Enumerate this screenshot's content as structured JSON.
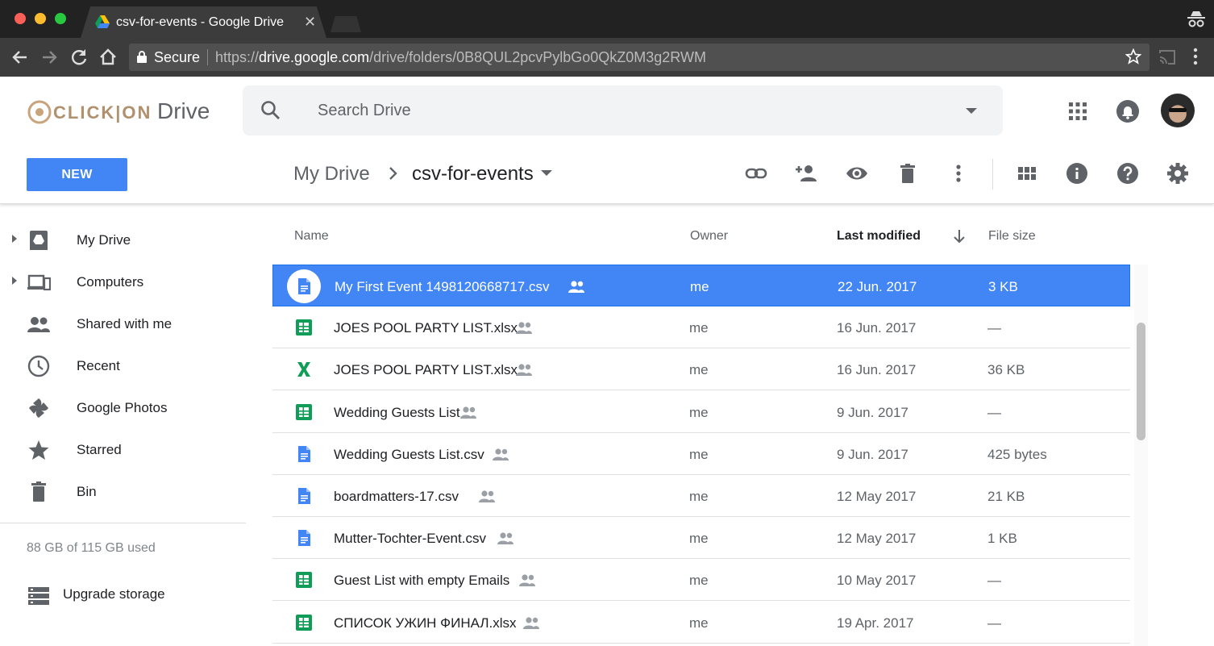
{
  "browser": {
    "tab_title": "csv-for-events - Google Drive",
    "secure_label": "Secure",
    "url_scheme": "https://",
    "url_host": "drive.google.com",
    "url_path": "/drive/folders/0B8QUL2pcvPylbGo0QkZ0M3g2RWM"
  },
  "header": {
    "brand": "CLICK|ON",
    "product": "Drive",
    "search_placeholder": "Search Drive"
  },
  "toolbar": {
    "new_label": "NEW",
    "breadcrumb_root": "My Drive",
    "breadcrumb_current": "csv-for-events"
  },
  "sidebar": {
    "items": [
      {
        "label": "My Drive",
        "icon": "my-drive-icon"
      },
      {
        "label": "Computers",
        "icon": "computers-icon"
      },
      {
        "label": "Shared with me",
        "icon": "shared-icon"
      },
      {
        "label": "Recent",
        "icon": "clock-icon"
      },
      {
        "label": "Google Photos",
        "icon": "photos-icon"
      },
      {
        "label": "Starred",
        "icon": "star-icon"
      },
      {
        "label": "Bin",
        "icon": "trash-icon"
      }
    ],
    "storage": "88 GB of 115 GB used",
    "upgrade": "Upgrade storage"
  },
  "list": {
    "columns": {
      "name": "Name",
      "owner": "Owner",
      "modified": "Last modified",
      "size": "File size"
    },
    "rows": [
      {
        "name": "My First Event 1498120668717.csv",
        "owner": "me",
        "modified": "22 Jun. 2017",
        "size": "3 KB",
        "type": "doc",
        "selected": true
      },
      {
        "name": "JOES POOL PARTY LIST.xlsx",
        "owner": "me",
        "modified": "16 Jun. 2017",
        "size": "—",
        "type": "sheet"
      },
      {
        "name": "JOES POOL PARTY LIST.xlsx",
        "owner": "me",
        "modified": "16 Jun. 2017",
        "size": "36 KB",
        "type": "excel"
      },
      {
        "name": "Wedding Guests List",
        "owner": "me",
        "modified": "9 Jun. 2017",
        "size": "—",
        "type": "sheet"
      },
      {
        "name": "Wedding Guests List.csv",
        "owner": "me",
        "modified": "9 Jun. 2017",
        "size": "425 bytes",
        "type": "doc"
      },
      {
        "name": "boardmatters-17.csv",
        "owner": "me",
        "modified": "12 May 2017",
        "size": "21 KB",
        "type": "doc"
      },
      {
        "name": "Mutter-Tochter-Event.csv",
        "owner": "me",
        "modified": "12 May 2017",
        "size": "1 KB",
        "type": "doc"
      },
      {
        "name": "Guest List with empty Emails",
        "owner": "me",
        "modified": "10 May 2017",
        "size": "—",
        "type": "sheet"
      },
      {
        "name": "СПИСОК УЖИН ФИНАЛ.xlsx",
        "owner": "me",
        "modified": "19 Apr. 2017",
        "size": "—",
        "type": "sheet"
      }
    ]
  },
  "colors": {
    "accent": "#4285f4",
    "sheet": "#0f9d58",
    "doc": "#4285f4"
  }
}
